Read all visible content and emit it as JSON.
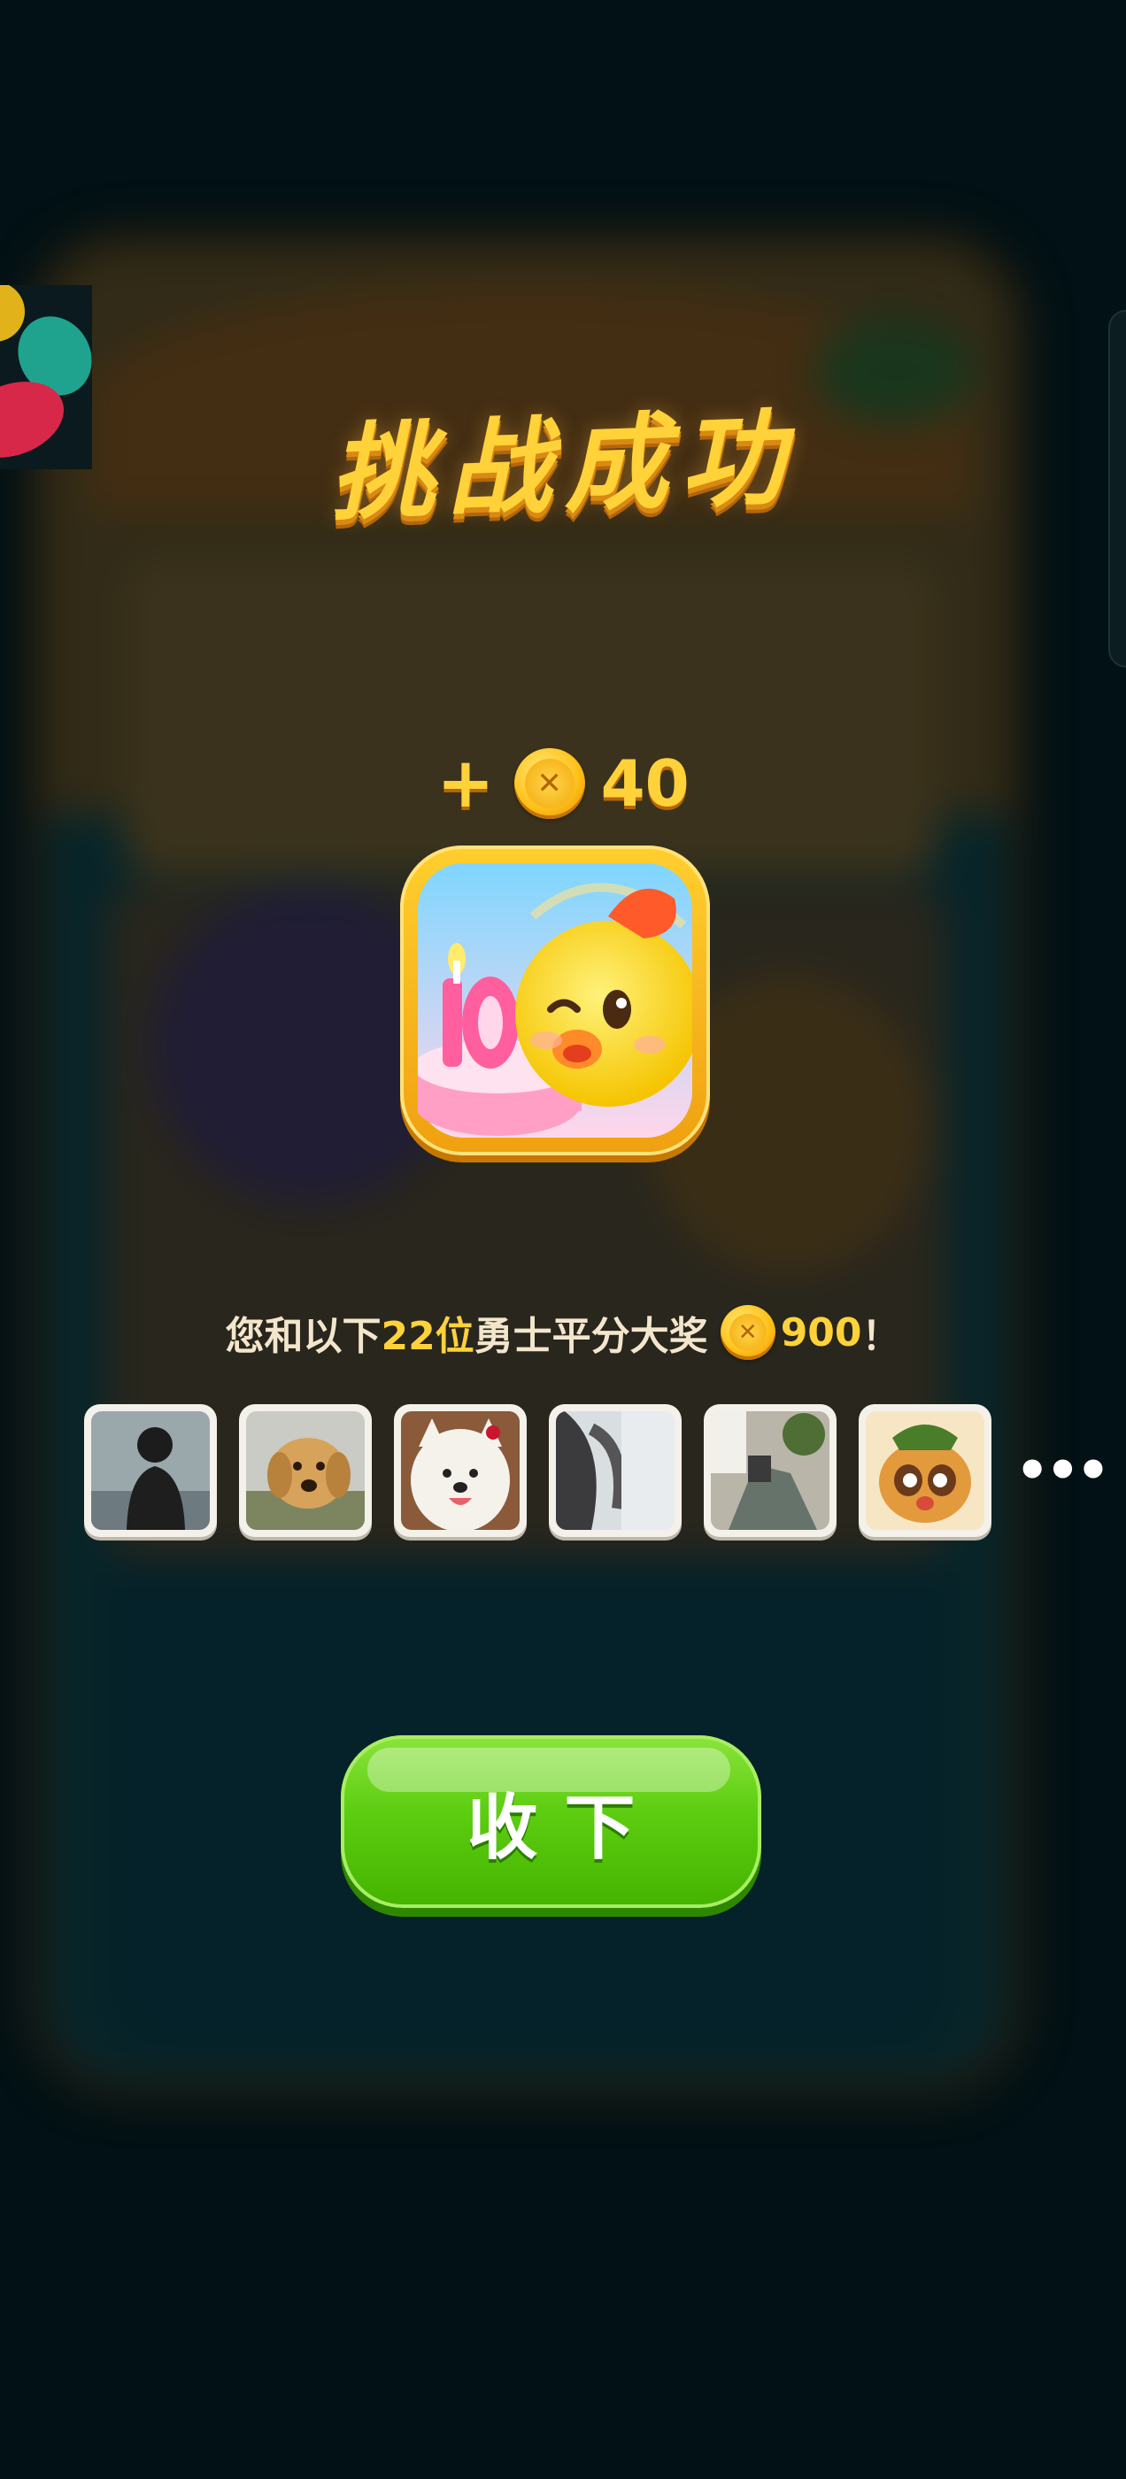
{
  "title": "挑战成功",
  "reward": {
    "plus": "+",
    "amount": "40",
    "coin_icon": "coin-icon"
  },
  "prize_icon": "chick-birthday-cake-icon",
  "share": {
    "prefix": "您和以下",
    "count": "22位",
    "middle": "勇士平分大奖",
    "total": "900",
    "suffix": "！"
  },
  "avatars": [
    {
      "name": "avatar-person-silhouette"
    },
    {
      "name": "avatar-golden-retriever"
    },
    {
      "name": "avatar-white-dog"
    },
    {
      "name": "avatar-person-hair"
    },
    {
      "name": "avatar-outdoor-photo"
    },
    {
      "name": "avatar-cartoon-raccoon"
    }
  ],
  "more": "•••",
  "button": {
    "label": "收下"
  },
  "colors": {
    "gold": "#ffd23a",
    "green": "#5ccd10",
    "text": "#f4e6cc"
  }
}
